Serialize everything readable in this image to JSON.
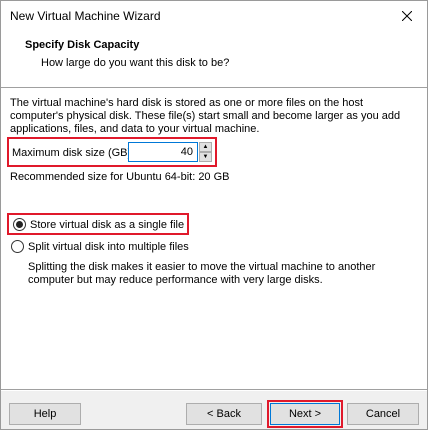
{
  "window": {
    "title": "New Virtual Machine Wizard"
  },
  "header": {
    "title": "Specify Disk Capacity",
    "subtitle": "How large do you want this disk to be?"
  },
  "content": {
    "description": "The virtual machine's hard disk is stored as one or more files on the host computer's physical disk. These file(s) start small and become larger as you add applications, files, and data to your virtual machine.",
    "size_label": "Maximum disk size (GB):",
    "size_value": "40",
    "recommended": "Recommended size for Ubuntu 64-bit: 20 GB",
    "option_single": "Store virtual disk as a single file",
    "option_split": "Split virtual disk into multiple files",
    "split_description": "Splitting the disk makes it easier to move the virtual machine to another computer but may reduce performance with very large disks.",
    "selected_option": "single"
  },
  "buttons": {
    "help": "Help",
    "back": "< Back",
    "next": "Next >",
    "cancel": "Cancel"
  },
  "colors": {
    "highlight": "#e0192b",
    "focus": "#0078d7"
  }
}
